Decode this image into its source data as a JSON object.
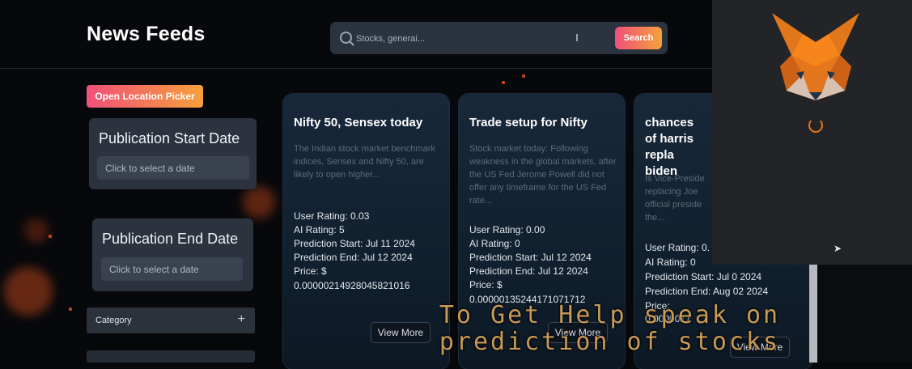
{
  "app": {
    "title": "News Feeds"
  },
  "search": {
    "placeholder": "Stocks, generai...",
    "button_label": "Search"
  },
  "sidebar": {
    "location_button": "Open Location Picker",
    "start_date": {
      "label": "Publication Start Date",
      "placeholder": "Click to select a date"
    },
    "end_date": {
      "label": "Publication End Date",
      "placeholder": "Click to select a date"
    },
    "category": {
      "label": "Category",
      "toggle": "+"
    }
  },
  "cards": [
    {
      "title": "Nifty 50, Sensex today",
      "description": "The Indian stock market benchmark indices, Sensex and Nifty 50, are likely to open higher...",
      "user_rating": "User Rating: 0.03",
      "ai_rating": "AI Rating: 5",
      "prediction_start": "Prediction Start: Jul 11 2024",
      "prediction_end": "Prediction End: Jul 12 2024",
      "price_label": "Price: $",
      "price_value": "0.00000214928045821016",
      "view_more": "View More"
    },
    {
      "title": "Trade setup for Nifty",
      "description": "Stock market today: Following weakness in the global markets, after the US Fed Jerome Powell did not offer any timeframe for the US Fed rate...",
      "user_rating": "User Rating: 0.00",
      "ai_rating": "AI Rating: 0",
      "prediction_start": "Prediction Start: Jul 12 2024",
      "prediction_end": "Prediction End: Jul 12 2024",
      "price_label": "Price: $",
      "price_value": "0.00000135244171071712",
      "view_more": "View More"
    },
    {
      "title": "chances of harris repla biden",
      "description": "Is Vice-Preside replacing Joe official preside the...",
      "user_rating": "User Rating: 0.",
      "ai_rating": "AI Rating: 0",
      "prediction_start": "Prediction Start: Jul 0 2024",
      "prediction_end": "Prediction End: Aug 02 2024",
      "price_label": "Price:",
      "price_value": "0.0000017",
      "view_more": "View More"
    }
  ],
  "caption": {
    "line1": "To Get Help   speak on",
    "line2": "prediction of stocks"
  },
  "colors": {
    "accent_gradient_start": "#f0507a",
    "accent_gradient_end": "#f6a03a",
    "fox_orange": "#e2761b",
    "caption": "#c89a56"
  },
  "icons": {
    "search": "search-icon",
    "wallet": "fox-icon",
    "loading": "spinner-icon"
  }
}
